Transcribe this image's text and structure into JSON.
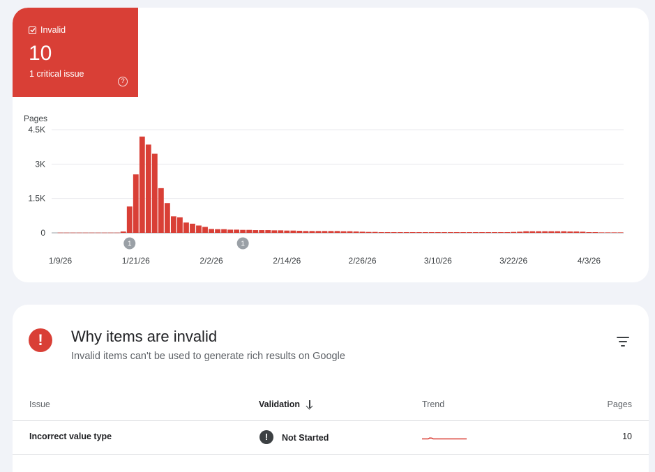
{
  "summary": {
    "label": "Invalid",
    "count": "10",
    "subtitle": "1 critical issue",
    "help_icon": "help-circle-icon",
    "color": "#d93f36"
  },
  "chart_data": {
    "type": "bar",
    "ylabel": "Pages",
    "yticks": [
      "0",
      "1.5K",
      "3K",
      "4.5K"
    ],
    "ytick_values": [
      0,
      1500,
      3000,
      4500
    ],
    "ylim": [
      0,
      4500
    ],
    "x_start": "1/9/26",
    "x_end": "4/6/26",
    "xtick_labels": [
      "1/9/26",
      "1/21/26",
      "2/2/26",
      "2/14/26",
      "2/26/26",
      "3/10/26",
      "3/22/26",
      "4/3/26"
    ],
    "annotations": [
      {
        "date": "1/20/26",
        "label": "1"
      },
      {
        "date": "2/7/26",
        "label": "1"
      }
    ],
    "bar_color": "#d93f36",
    "grid": true,
    "values": [
      10,
      10,
      10,
      10,
      10,
      10,
      10,
      10,
      10,
      10,
      60,
      1150,
      2550,
      4200,
      3850,
      3450,
      1950,
      1300,
      720,
      680,
      450,
      400,
      320,
      260,
      170,
      160,
      160,
      140,
      140,
      130,
      130,
      120,
      120,
      120,
      110,
      110,
      100,
      100,
      90,
      80,
      80,
      80,
      80,
      80,
      80,
      70,
      70,
      60,
      50,
      40,
      40,
      30,
      30,
      30,
      30,
      30,
      30,
      30,
      30,
      30,
      30,
      30,
      30,
      30,
      30,
      30,
      30,
      30,
      30,
      30,
      30,
      30,
      40,
      50,
      70,
      70,
      70,
      70,
      70,
      70,
      70,
      60,
      60,
      50,
      30,
      30,
      20,
      20,
      20,
      20
    ]
  },
  "issues": {
    "title": "Why items are invalid",
    "subtitle": "Invalid items can't be used to generate rich results on Google",
    "header_icon": "error-icon",
    "filter_icon": "filter-icon",
    "columns": {
      "issue": "Issue",
      "validation": "Validation",
      "trend": "Trend",
      "pages": "Pages"
    },
    "sort_icon": "arrow-down-icon",
    "rows": [
      {
        "issue": "Incorrect value type",
        "validation": "Not Started",
        "status_icon": "exclamation-icon",
        "pages": "10"
      }
    ]
  }
}
